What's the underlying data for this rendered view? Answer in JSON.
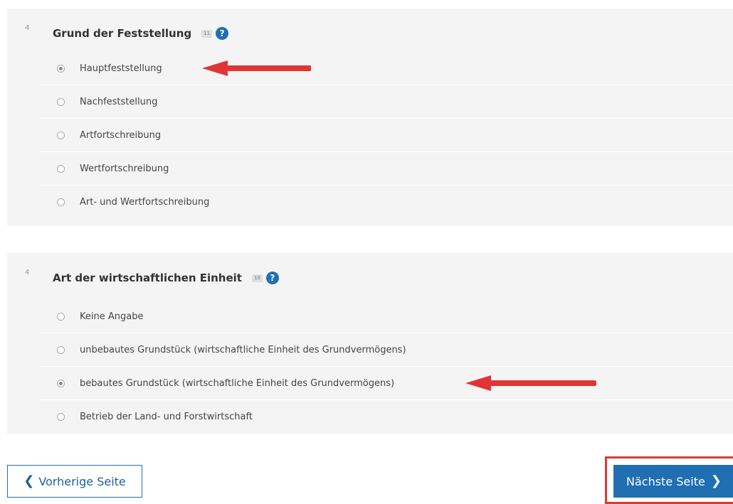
{
  "colors": {
    "primary": "#1f6fb2",
    "annotation_red": "#e03535",
    "section_bg": "#f4f4f4"
  },
  "sections": [
    {
      "number": "4",
      "title": "Grund der Feststellung",
      "badge": "11",
      "help_icon": "?",
      "options": [
        {
          "label": "Hauptfeststellung",
          "selected": true
        },
        {
          "label": "Nachfeststellung",
          "selected": false
        },
        {
          "label": "Artfortschreibung",
          "selected": false
        },
        {
          "label": "Wertfortschreibung",
          "selected": false
        },
        {
          "label": "Art- und Wertfortschreibung",
          "selected": false
        }
      ]
    },
    {
      "number": "4",
      "title": "Art der wirtschaftlichen Einheit",
      "badge": "10",
      "help_icon": "?",
      "options": [
        {
          "label": "Keine Angabe",
          "selected": false
        },
        {
          "label": "unbebautes Grundstück (wirtschaftliche Einheit des Grundvermögens)",
          "selected": false
        },
        {
          "label": "bebautes Grundstück (wirtschaftliche Einheit des Grundvermögens)",
          "selected": true
        },
        {
          "label": "Betrieb der Land- und Forstwirtschaft",
          "selected": false
        }
      ]
    }
  ],
  "navigation": {
    "prev_label": "Vorherige Seite",
    "prev_icon": "chevron-left-icon",
    "next_label": "Nächste Seite",
    "next_icon": "chevron-right-icon"
  }
}
